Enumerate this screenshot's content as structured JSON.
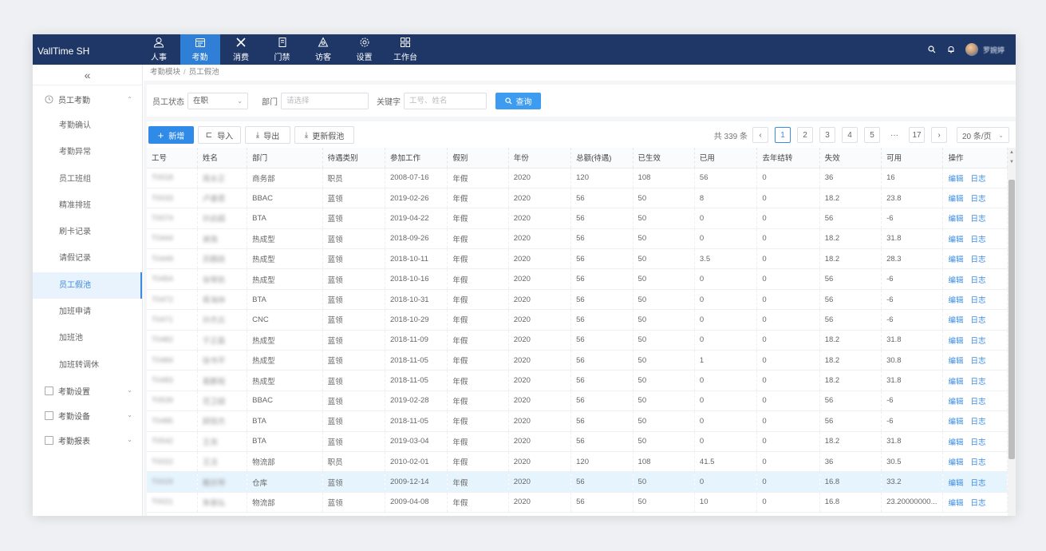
{
  "app": {
    "brand": "VallTime SH",
    "nav": [
      {
        "label": "人事",
        "icon": "person-icon"
      },
      {
        "label": "考勤",
        "icon": "calendar-icon",
        "active": true
      },
      {
        "label": "消费",
        "icon": "utensils-icon"
      },
      {
        "label": "门禁",
        "icon": "door-icon"
      },
      {
        "label": "访客",
        "icon": "visitor-icon"
      },
      {
        "label": "设置",
        "icon": "gear-icon"
      },
      {
        "label": "工作台",
        "icon": "grid-icon"
      }
    ],
    "user_name": "罗婉婷",
    "accent_color": "#2f7fd6",
    "topbar_color": "#1e3766"
  },
  "sidebar": {
    "collapse_glyph": "«",
    "group1": {
      "label": "员工考勤",
      "expanded": true
    },
    "items": [
      "考勤确认",
      "考勤异常",
      "员工班组",
      "精准排班",
      "刷卡记录",
      "请假记录",
      "员工假池",
      "加班申请",
      "加班池",
      "加班转调休"
    ],
    "active_item": "员工假池",
    "groups_collapsed": [
      "考勤设置",
      "考勤设备",
      "考勤报表"
    ]
  },
  "breadcrumb": {
    "parent": "考勤模块",
    "sep": "/",
    "current": "员工假池"
  },
  "filter": {
    "status_label": "员工状态",
    "status_value": "在职",
    "dept_label": "部门",
    "dept_placeholder": "请选择",
    "keyword_label": "关键字",
    "keyword_placeholder": "工号、姓名",
    "query_button": "查询"
  },
  "toolbar": {
    "add": "新增",
    "import": "导入",
    "export": "导出",
    "refresh": "更新假池"
  },
  "pager": {
    "total": "共 339 条",
    "pages": [
      "1",
      "2",
      "3",
      "4",
      "5"
    ],
    "dots": "···",
    "last": "17",
    "current": "1",
    "page_size": "20 条/页"
  },
  "table": {
    "columns": [
      "工号",
      "姓名",
      "部门",
      "待遇类别",
      "参加工作",
      "假别",
      "年份",
      "总额(待遇)",
      "已生效",
      "已用",
      "去年结转",
      "失效",
      "可用",
      "操作"
    ],
    "actions": [
      "编辑",
      "日志"
    ],
    "rows": [
      [
        "T0018",
        "周永正",
        "商务部",
        "职员",
        "2008-07-16",
        "年假",
        "2020",
        "120",
        "108",
        "56",
        "0",
        "36",
        "16"
      ],
      [
        "T0033",
        "卢睿君",
        "BBAC",
        "蓝领",
        "2019-02-26",
        "年假",
        "2020",
        "56",
        "50",
        "8",
        "0",
        "18.2",
        "23.8"
      ],
      [
        "T0074",
        "孙启超",
        "BTA",
        "蓝领",
        "2019-04-22",
        "年假",
        "2020",
        "56",
        "50",
        "0",
        "0",
        "56",
        "-6"
      ],
      [
        "T0444",
        "谢逸",
        "热成型",
        "蓝领",
        "2018-09-26",
        "年假",
        "2020",
        "56",
        "50",
        "0",
        "0",
        "18.2",
        "31.8"
      ],
      [
        "T0449",
        "苏麒政",
        "热成型",
        "蓝领",
        "2018-10-11",
        "年假",
        "2020",
        "56",
        "50",
        "3.5",
        "0",
        "18.2",
        "28.3"
      ],
      [
        "T0454",
        "张琴凯",
        "热成型",
        "蓝领",
        "2018-10-16",
        "年假",
        "2020",
        "56",
        "50",
        "0",
        "0",
        "56",
        "-6"
      ],
      [
        "T0472",
        "蒋海林",
        "BTA",
        "蓝领",
        "2018-10-31",
        "年假",
        "2020",
        "56",
        "50",
        "0",
        "0",
        "56",
        "-6"
      ],
      [
        "T0471",
        "孙杰云",
        "CNC",
        "蓝领",
        "2018-10-29",
        "年假",
        "2020",
        "56",
        "50",
        "0",
        "0",
        "56",
        "-6"
      ],
      [
        "T0482",
        "于正磊",
        "热成型",
        "蓝领",
        "2018-11-09",
        "年假",
        "2020",
        "56",
        "50",
        "0",
        "0",
        "18.2",
        "31.8"
      ],
      [
        "T0484",
        "徐书平",
        "热成型",
        "蓝领",
        "2018-11-05",
        "年假",
        "2020",
        "56",
        "50",
        "1",
        "0",
        "18.2",
        "30.8"
      ],
      [
        "T0483",
        "葛鹏程",
        "热成型",
        "蓝领",
        "2018-11-05",
        "年假",
        "2020",
        "56",
        "50",
        "0",
        "0",
        "18.2",
        "31.8"
      ],
      [
        "T0539",
        "范卫超",
        "BBAC",
        "蓝领",
        "2019-02-28",
        "年假",
        "2020",
        "56",
        "50",
        "0",
        "0",
        "56",
        "-6"
      ],
      [
        "T0485",
        "顾锐杰",
        "BTA",
        "蓝领",
        "2018-11-05",
        "年假",
        "2020",
        "56",
        "50",
        "0",
        "0",
        "56",
        "-6"
      ],
      [
        "T0542",
        "王尧",
        "BTA",
        "蓝领",
        "2019-03-04",
        "年假",
        "2020",
        "56",
        "50",
        "0",
        "0",
        "18.2",
        "31.8"
      ],
      [
        "T0022",
        "王洁",
        "物流部",
        "职员",
        "2010-02-01",
        "年假",
        "2020",
        "120",
        "108",
        "41.5",
        "0",
        "36",
        "30.5"
      ],
      [
        "T0029",
        "戴欣琴",
        "仓库",
        "蓝领",
        "2009-12-14",
        "年假",
        "2020",
        "56",
        "50",
        "0",
        "0",
        "16.8",
        "33.2"
      ],
      [
        "T0021",
        "朱振弘",
        "物流部",
        "蓝领",
        "2009-04-08",
        "年假",
        "2020",
        "56",
        "50",
        "10",
        "0",
        "16.8",
        "23.20000000..."
      ]
    ],
    "highlighted_row": 15
  }
}
